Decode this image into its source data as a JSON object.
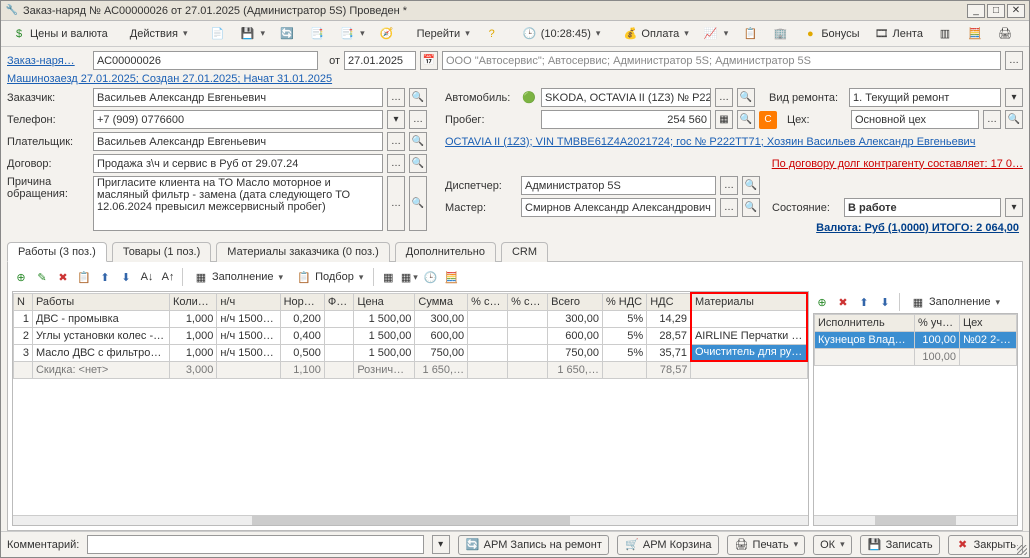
{
  "title": "Заказ-наряд № АС00000026 от 27.01.2025 (Администратор 5S) Проведен *",
  "toolbar": {
    "prices": "Цены и валюта",
    "actions": "Действия",
    "go": "Перейти",
    "time": "(10:28:45)",
    "pay": "Оплата",
    "bonus": "Бонусы",
    "lenta": "Лента"
  },
  "hdr": {
    "orderLbl": "Заказ-наря…",
    "orderNo": "АС00000026",
    "fromLbl": "от",
    "date": "27.01.2025",
    "org": "ООО \"Автосервис\"; Автосервис; Администратор 5S; Администратор 5S",
    "statusline": "Машинозаезд 27.01.2025; Создан 27.01.2025; Начат 31.01.2025",
    "customerLbl": "Заказчик:",
    "customer": "Васильев Александр Евгеньевич",
    "carLbl": "Автомобиль:",
    "car": "SKODA, OCTAVIA II (1Z3) № Р222…",
    "repairLbl": "Вид ремонта:",
    "repair": "1. Текущий ремонт",
    "phoneLbl": "Телефон:",
    "phone": "+7 (909) 0776600",
    "mileageLbl": "Пробег:",
    "mileage": "254 560",
    "shopLbl": "Цех:",
    "shop": "Основной цех",
    "payerLbl": "Плательщик:",
    "payer": "Васильев Александр Евгеньевич",
    "vinline": "OCTAVIA II (1Z3); VIN TMBBE61Z4A2021724; гос № Р222ТТ71; Хозяин Васильев Александр Евгеньевич",
    "contractLbl": "Договор:",
    "contract": "Продажа з\\ч и сервис в Руб от 29.07.24",
    "debt": "По договору долг контрагенту составляет: 17 0…",
    "reasonLbl": "Причина обращения:",
    "reason": "Пригласите клиента на ТО\nМасло моторное и масляный фильтр - замена (дата следующего ТО 12.06.2024 превысил межсервисный пробег)",
    "dispLbl": "Диспетчер:",
    "disp": "Администратор 5S",
    "masterLbl": "Мастер:",
    "master": "Смирнов Александр Александрович",
    "stateLbl": "Состояние:",
    "state": "В работе",
    "totals": "Валюта: Руб (1,0000) ИТОГО: 2 064,00"
  },
  "tabs": {
    "works": "Работы (3 поз.)",
    "goods": "Товары (1 поз.)",
    "mat": "Материалы заказчика (0 поз.)",
    "extra": "Дополнительно",
    "crm": "CRM"
  },
  "sub": {
    "fill": "Заполнение",
    "pick": "Подбор"
  },
  "cols": {
    "n": "N",
    "work": "Работы",
    "qty": "Колич…",
    "nh": "н/ч",
    "norm": "Норм…",
    "fi": "Фи…",
    "price": "Цена",
    "sum": "Сумма",
    "d1": "% ск…",
    "d2": "% ск…",
    "total": "Всего",
    "vatp": "% НДС",
    "vat": "НДС",
    "mat": "Материалы"
  },
  "rows": [
    {
      "n": "1",
      "w": "ДВС - промывка",
      "q": "1,000",
      "nh": "н/ч 1500 …",
      "norm": "0,200",
      "fi": "",
      "price": "1 500,00",
      "sum": "300,00",
      "d1": "",
      "d2": "",
      "total": "300,00",
      "vatp": "5%",
      "vat": "14,29",
      "mat": ""
    },
    {
      "n": "2",
      "w": "Углы установки колес - …",
      "q": "1,000",
      "nh": "н/ч 1500 …",
      "norm": "0,400",
      "fi": "",
      "price": "1 500,00",
      "sum": "600,00",
      "d1": "",
      "d2": "",
      "total": "600,00",
      "vatp": "5%",
      "vat": "28,57",
      "mat": "AIRLINE Перчатки м…"
    },
    {
      "n": "3",
      "w": "Масло ДВС с фильтром …",
      "q": "1,000",
      "nh": "н/ч 1500 …",
      "norm": "0,500",
      "fi": "",
      "price": "1 500,00",
      "sum": "750,00",
      "d1": "",
      "d2": "",
      "total": "750,00",
      "vatp": "5%",
      "vat": "35,71",
      "mat": "Очиститель для рук…"
    }
  ],
  "foot": {
    "discount": "Скидка: <нет>",
    "q": "3,000",
    "norm": "1,100",
    "price": "Рознич…",
    "sum": "1 650,…",
    "total": "1 650,…",
    "vat": "78,57"
  },
  "rightcols": {
    "executor": "Исполнитель",
    "pct": "% уча…",
    "shop": "Цех"
  },
  "rightrows": [
    {
      "e": "Кузнецов Владим…",
      "p": "100,00",
      "s": "№02 2-х стое…"
    }
  ],
  "rightfoot": {
    "p": "100,00"
  },
  "status": {
    "commentLbl": "Комментарий:",
    "armRec": "АРМ Запись на ремонт",
    "armCart": "АРМ Корзина",
    "print": "Печать",
    "ok": "ОК",
    "save": "Записать",
    "close": "Закрыть"
  }
}
